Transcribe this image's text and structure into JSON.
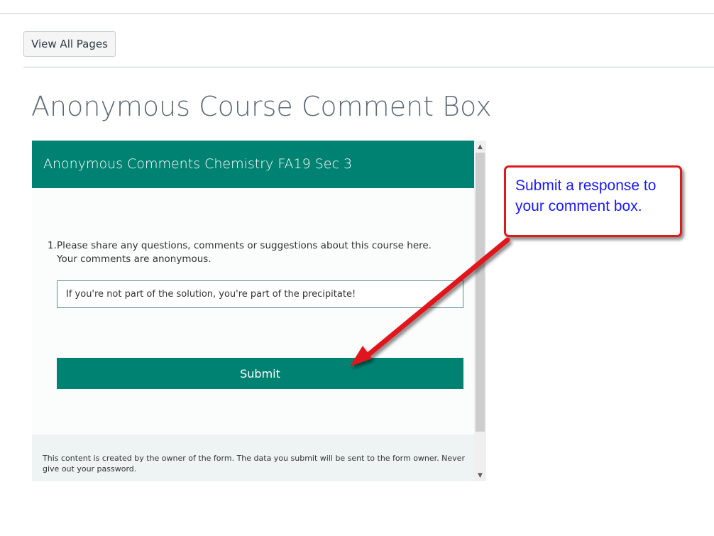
{
  "nav": {
    "view_all_pages_label": "View All Pages"
  },
  "page": {
    "title": "Anonymous Course Comment Box"
  },
  "form": {
    "header_title": "Anonymous Comments Chemistry FA19 Sec 3",
    "question_number": "1.",
    "question_text": "Please share any questions, comments or suggestions about this course here. Your comments are anonymous.",
    "answer_value": "If you're not part of the solution, you're part of the precipitate!",
    "submit_label": "Submit",
    "footer_text": "This content is created by the owner of the form. The data you submit will be sent to the form owner. Never give out your password."
  },
  "scrollbar": {
    "up_icon": "chevron-up-icon",
    "down_icon": "chevron-down-icon"
  },
  "callout": {
    "text": "Submit a response to your comment box."
  },
  "colors": {
    "accent": "#008272",
    "callout_border": "#e0191b",
    "callout_text": "#1a1aff"
  }
}
